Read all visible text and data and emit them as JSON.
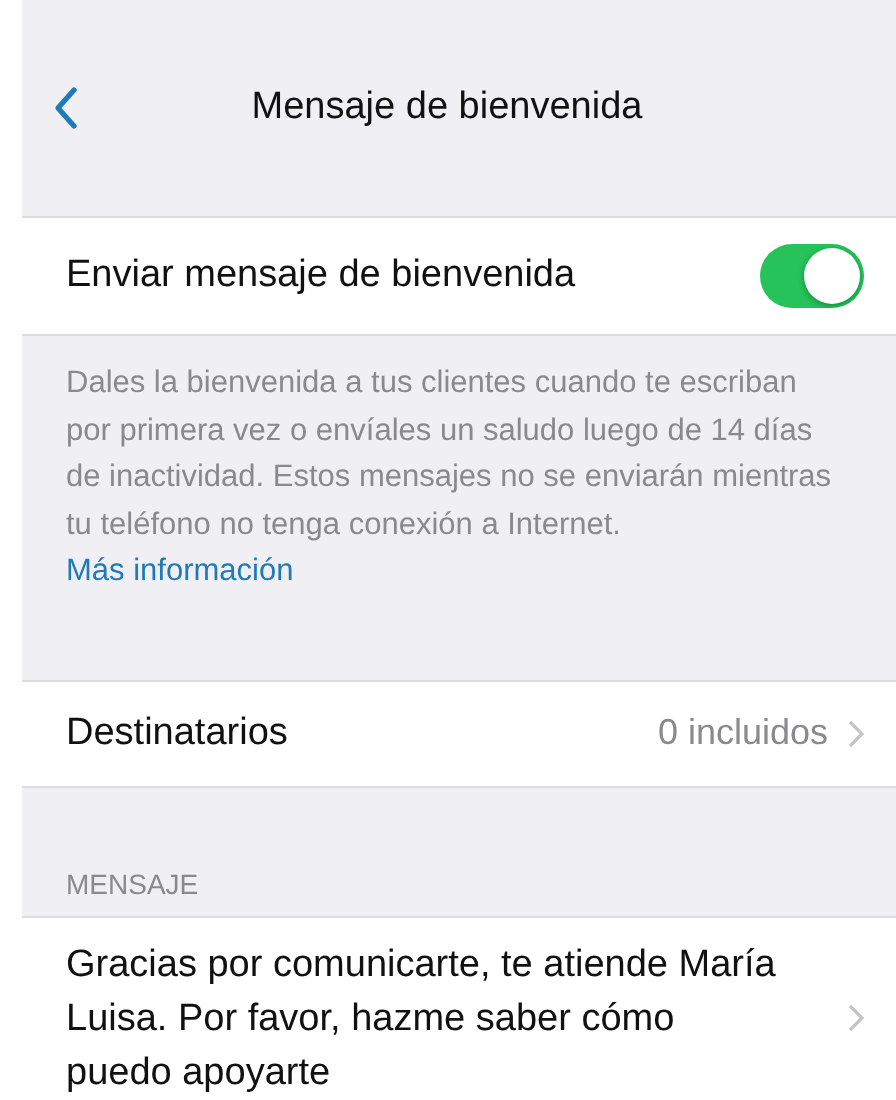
{
  "nav": {
    "title": "Mensaje de bienvenida"
  },
  "toggle_row": {
    "label": "Enviar mensaje de bienvenida",
    "on": true
  },
  "description": {
    "text": "Dales la bienvenida a tus clientes cuando te escriban por primera vez o envíales un saludo luego de 14 días de inactividad. Estos mensajes no se enviarán mientras tu teléfono no tenga conexión a Internet.",
    "link": "Más información"
  },
  "recipients_row": {
    "label": "Destinatarios",
    "value": "0 incluidos"
  },
  "message_section": {
    "header": "MENSAJE",
    "text": "Gracias por comunicarte, te atiende María Luisa. Por favor, hazme saber cómo puedo apoyarte"
  }
}
